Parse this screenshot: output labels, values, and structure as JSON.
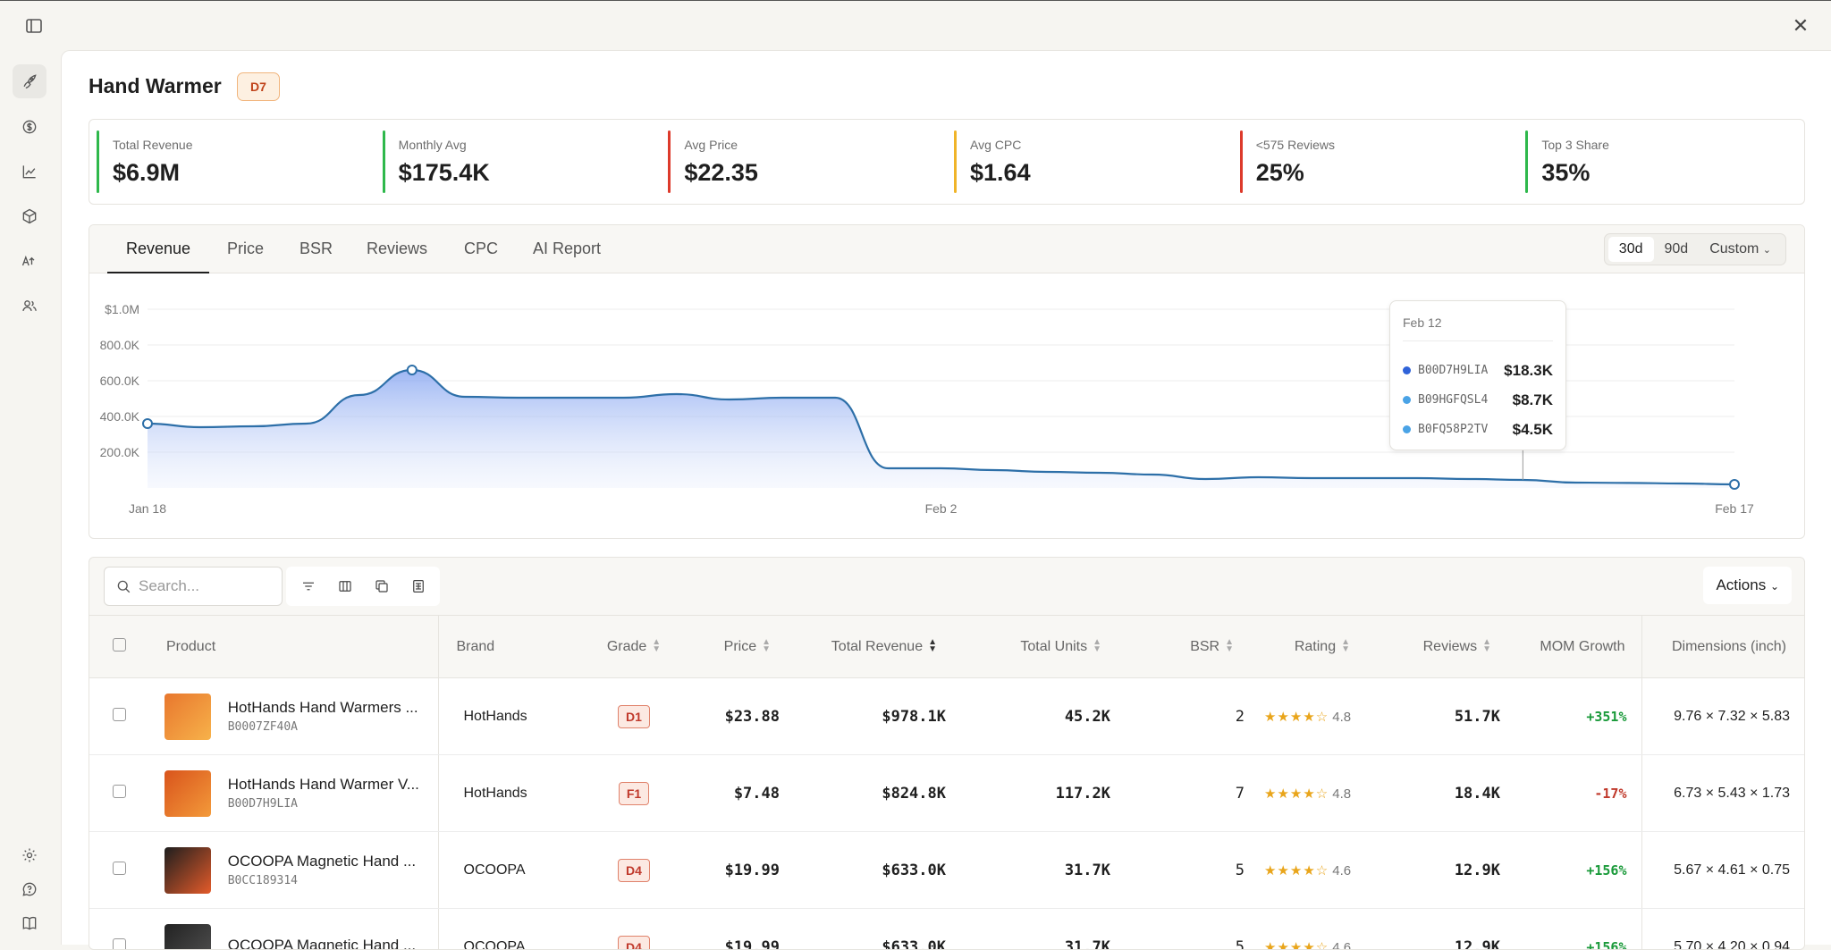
{
  "header": {
    "title": "Hand Warmer",
    "grade": "D7"
  },
  "kpis": [
    {
      "label": "Total Revenue",
      "value": "$6.9M",
      "color": "#2eb84b"
    },
    {
      "label": "Monthly Avg",
      "value": "$175.4K",
      "color": "#2eb84b"
    },
    {
      "label": "Avg Price",
      "value": "$22.35",
      "color": "#dd3a2b"
    },
    {
      "label": "Avg CPC",
      "value": "$1.64",
      "color": "#f0b429"
    },
    {
      "label": "<575 Reviews",
      "value": "25%",
      "color": "#dd3a2b"
    },
    {
      "label": "Top 3 Share",
      "value": "35%",
      "color": "#2eb84b"
    }
  ],
  "tabs": [
    "Revenue",
    "Price",
    "BSR",
    "Reviews",
    "CPC",
    "AI Report"
  ],
  "range": {
    "options": [
      "30d",
      "90d",
      "Custom"
    ],
    "active": "30d"
  },
  "chart_data": {
    "type": "area",
    "x_labels": [
      "Jan 18",
      "Feb 2",
      "Feb 17"
    ],
    "y_ticks": [
      "$1.0M",
      "800.0K",
      "600.0K",
      "400.0K",
      "200.0K"
    ],
    "ylim": [
      0,
      1000000
    ],
    "values": [
      360000,
      340000,
      345000,
      360000,
      520000,
      660000,
      510000,
      505000,
      505000,
      505000,
      525000,
      495000,
      505000,
      505000,
      110000,
      110000,
      100000,
      90000,
      85000,
      75000,
      50000,
      60000,
      55000,
      55000,
      55000,
      50000,
      45000,
      30000,
      28000,
      25000,
      20000
    ],
    "grid": true,
    "color": "#3a6fd8",
    "tooltip": {
      "date": "Feb 12",
      "items": [
        {
          "asin": "B00D7H9LIA",
          "amount": "$18.3K",
          "color": "#2f63d9"
        },
        {
          "asin": "B09HGFQSL4",
          "amount": "$8.7K",
          "color": "#4aa3e6"
        },
        {
          "asin": "B0FQ58P2TV",
          "amount": "$4.5K",
          "color": "#4aa3e6"
        }
      ]
    }
  },
  "table": {
    "search_placeholder": "Search...",
    "actions_label": "Actions",
    "columns": [
      "Product",
      "Brand",
      "Grade",
      "Price",
      "Total Revenue",
      "Total Units",
      "BSR",
      "Rating",
      "Reviews",
      "MOM Growth",
      "Dimensions (inch)"
    ],
    "rows": [
      {
        "name": "HotHands Hand Warmers ...",
        "asin": "B0007ZF40A",
        "brand": "HotHands",
        "grade": "D1",
        "price": "$23.88",
        "revenue": "$978.1K",
        "units": "45.2K",
        "bsr": "2",
        "stars": "★★★★☆",
        "rating": "4.8",
        "reviews": "51.7K",
        "growth": "+351%",
        "growth_sign": "pos",
        "dims": "9.76 × 7.32 × 5.83"
      },
      {
        "name": "HotHands Hand Warmer V...",
        "asin": "B00D7H9LIA",
        "brand": "HotHands",
        "grade": "F1",
        "price": "$7.48",
        "revenue": "$824.8K",
        "units": "117.2K",
        "bsr": "7",
        "stars": "★★★★☆",
        "rating": "4.8",
        "reviews": "18.4K",
        "growth": "-17%",
        "growth_sign": "neg",
        "dims": "6.73 × 5.43 × 1.73"
      },
      {
        "name": "OCOOPA Magnetic Hand ...",
        "asin": "B0CC189314",
        "brand": "OCOOPA",
        "grade": "D4",
        "price": "$19.99",
        "revenue": "$633.0K",
        "units": "31.7K",
        "bsr": "5",
        "stars": "★★★★☆",
        "rating": "4.6",
        "reviews": "12.9K",
        "growth": "+156%",
        "growth_sign": "pos",
        "dims": "5.67 × 4.61 × 0.75"
      },
      {
        "name": "OCOOPA Magnetic Hand ...",
        "asin": "",
        "brand": "OCOOPA",
        "grade": "D4",
        "price": "$19.99",
        "revenue": "$633.0K",
        "units": "31.7K",
        "bsr": "5",
        "stars": "★★★★☆",
        "rating": "4.6",
        "reviews": "12.9K",
        "growth": "+156%",
        "growth_sign": "pos",
        "dims": "5.70 × 4.20 × 0.94"
      }
    ]
  }
}
